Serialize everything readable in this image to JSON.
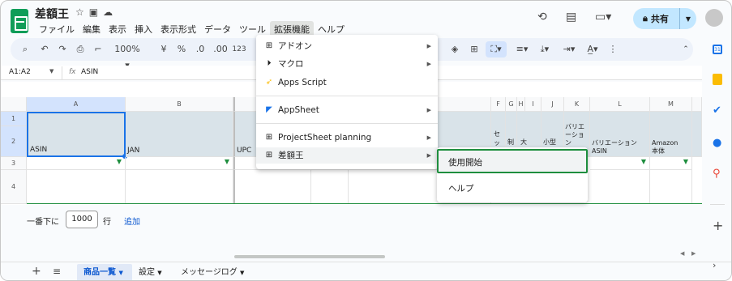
{
  "app": {
    "title": "差額王"
  },
  "menubar": {
    "items": [
      "ファイル",
      "編集",
      "表示",
      "挿入",
      "表示形式",
      "データ",
      "ツール",
      "拡張機能",
      "ヘルプ"
    ],
    "active": "拡張機能"
  },
  "header": {
    "share_label": "共有"
  },
  "toolbar": {
    "zoom": "100%",
    "currency": "¥",
    "percent": "%",
    "dec_decrease": ".0",
    "dec_increase": ".00",
    "number_format": "123"
  },
  "formula_bar": {
    "cell_ref": "A1:A2",
    "fx": "fx",
    "content": "ASIN"
  },
  "columns": {
    "left": [
      "A",
      "B"
    ],
    "right": [
      "F",
      "G",
      "H",
      "I",
      "J",
      "K",
      "L",
      "M"
    ]
  },
  "rows": [
    "1",
    "2",
    "3",
    "4"
  ],
  "header_cells": {
    "a": "ASIN",
    "b": "JAN",
    "c": "UPC",
    "f": "セッ",
    "g": "制",
    "h": "大",
    "j": "小型",
    "k": "バリエーション",
    "l": "バリエーション ASIN",
    "m": "Amazon 本体"
  },
  "add_rows": {
    "prefix": "一番下に",
    "count": "1000",
    "unit": "行",
    "button": "追加"
  },
  "sheets": [
    "商品一覧",
    "設定",
    "メッセージログ"
  ],
  "active_sheet": "商品一覧",
  "extensions_menu": [
    {
      "label": "アドオン",
      "icon": "addon-icon",
      "submenu": true
    },
    {
      "label": "マクロ",
      "icon": "macro-icon",
      "submenu": true
    },
    {
      "label": "Apps Script",
      "icon": "apps-script-icon",
      "submenu": false
    },
    {
      "label": "AppSheet",
      "icon": "appsheet-icon",
      "submenu": true
    },
    {
      "label": "ProjectSheet planning",
      "icon": "addon-icon",
      "submenu": true
    },
    {
      "label": "差額王",
      "icon": "addon-icon",
      "submenu": true
    }
  ],
  "submenu": [
    {
      "label": "使用開始",
      "highlighted": true
    },
    {
      "label": "ヘルプ"
    }
  ],
  "colors": {
    "accent": "#0b57d0",
    "highlight_box": "#1e8e3e",
    "header_fill": "#d9e3e9",
    "share_bg": "#c2e7ff"
  }
}
